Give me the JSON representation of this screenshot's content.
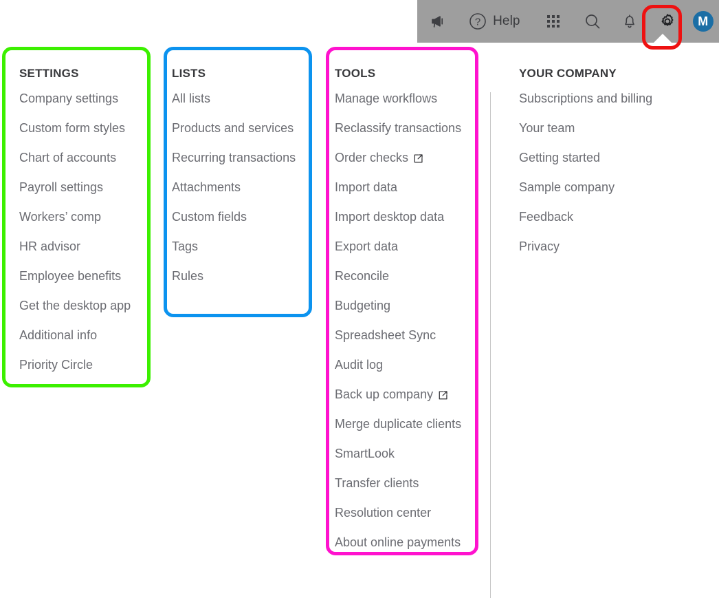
{
  "topbar": {
    "background_color": "#9e9e9e",
    "items": [
      {
        "name": "megaphone-icon",
        "label": ""
      },
      {
        "name": "help-button",
        "label": "Help"
      },
      {
        "name": "apps-grid-icon",
        "label": ""
      },
      {
        "name": "search-icon",
        "label": ""
      },
      {
        "name": "notifications-bell-icon",
        "label": ""
      },
      {
        "name": "gear-icon",
        "label": ""
      },
      {
        "name": "user-avatar",
        "label": "M"
      }
    ],
    "help_label": "Help",
    "avatar_initial": "M",
    "avatar_color": "#1b6ea5"
  },
  "annotations": {
    "gear_highlight_color": "#ee1111",
    "settings_box_color": "#3cf000",
    "lists_box_color": "#0c93ef",
    "tools_box_color": "#ff12ce"
  },
  "menu": {
    "columns": [
      {
        "id": "settings",
        "title": "SETTINGS",
        "items": [
          {
            "label": "Company settings",
            "external": false
          },
          {
            "label": "Custom form styles",
            "external": false
          },
          {
            "label": "Chart of accounts",
            "external": false
          },
          {
            "label": "Payroll settings",
            "external": false
          },
          {
            "label": "Workers’ comp",
            "external": false
          },
          {
            "label": "HR advisor",
            "external": false
          },
          {
            "label": "Employee benefits",
            "external": false
          },
          {
            "label": "Get the desktop app",
            "external": false
          },
          {
            "label": "Additional info",
            "external": false
          },
          {
            "label": "Priority Circle",
            "external": false
          }
        ]
      },
      {
        "id": "lists",
        "title": "LISTS",
        "items": [
          {
            "label": "All lists",
            "external": false
          },
          {
            "label": "Products and services",
            "external": false
          },
          {
            "label": "Recurring transactions",
            "external": false
          },
          {
            "label": "Attachments",
            "external": false
          },
          {
            "label": "Custom fields",
            "external": false
          },
          {
            "label": "Tags",
            "external": false
          },
          {
            "label": "Rules",
            "external": false
          }
        ]
      },
      {
        "id": "tools",
        "title": "TOOLS",
        "items": [
          {
            "label": "Manage workflows",
            "external": false
          },
          {
            "label": "Reclassify transactions",
            "external": false
          },
          {
            "label": "Order checks",
            "external": true
          },
          {
            "label": "Import data",
            "external": false
          },
          {
            "label": "Import desktop data",
            "external": false
          },
          {
            "label": "Export data",
            "external": false
          },
          {
            "label": "Reconcile",
            "external": false
          },
          {
            "label": "Budgeting",
            "external": false
          },
          {
            "label": "Spreadsheet Sync",
            "external": false
          },
          {
            "label": "Audit log",
            "external": false
          },
          {
            "label": "Back up company",
            "external": true
          },
          {
            "label": "Merge duplicate clients",
            "external": false
          },
          {
            "label": "SmartLook",
            "external": false
          },
          {
            "label": "Transfer clients",
            "external": false
          },
          {
            "label": "Resolution center",
            "external": false
          },
          {
            "label": "About online payments",
            "external": false
          }
        ]
      },
      {
        "id": "company",
        "title": "YOUR COMPANY",
        "items": [
          {
            "label": "Subscriptions and billing",
            "external": false
          },
          {
            "label": "Your team",
            "external": false
          },
          {
            "label": "Getting started",
            "external": false
          },
          {
            "label": "Sample company",
            "external": false
          },
          {
            "label": "Feedback",
            "external": false
          },
          {
            "label": "Privacy",
            "external": false
          }
        ]
      }
    ]
  }
}
